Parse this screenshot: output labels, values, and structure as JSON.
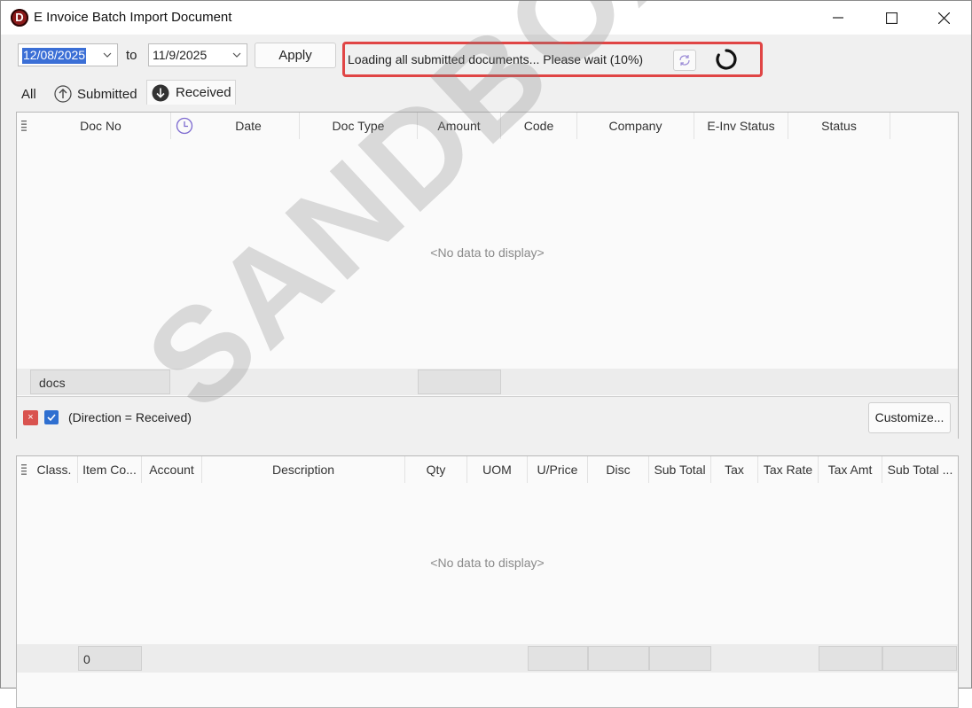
{
  "window": {
    "app_icon_letter": "D",
    "title": "E Invoice Batch Import Document"
  },
  "toolbar": {
    "date_from": "12/08/2025",
    "to_label": "to",
    "date_to": "11/9/2025",
    "apply_label": "Apply",
    "status_text": "Loading all submitted documents... Please wait (10%)",
    "progress_percent": 10
  },
  "tabs": [
    {
      "label": "All",
      "icon": "none",
      "active": false
    },
    {
      "label": "Submitted",
      "icon": "arrow-up-circle-icon",
      "active": false
    },
    {
      "label": "Received",
      "icon": "arrow-down-circle-icon",
      "active": true
    }
  ],
  "doc_grid": {
    "columns": [
      "Doc No",
      "Date",
      "Doc Type",
      "Amount",
      "Code",
      "Company",
      "E-Inv Status",
      "Status"
    ],
    "empty_text": "<No data to display>",
    "footer_summary": "docs"
  },
  "filter": {
    "text": "(Direction = Received)",
    "close_glyph": "×",
    "enabled": true,
    "customize_label": "Customize..."
  },
  "detail_grid": {
    "columns": [
      "Class.",
      "Item Co...",
      "Account",
      "Description",
      "Qty",
      "UOM",
      "U/Price",
      "Disc",
      "Sub Total",
      "Tax",
      "Tax Rate",
      "Tax Amt",
      "Sub Total ..."
    ],
    "empty_text": "<No data to display>",
    "footer_count": "0"
  },
  "watermark": "SANDBOX",
  "colors": {
    "highlight_border": "#e04545",
    "selection": "#3b6fd6",
    "app_icon": "#8b1a1a"
  }
}
